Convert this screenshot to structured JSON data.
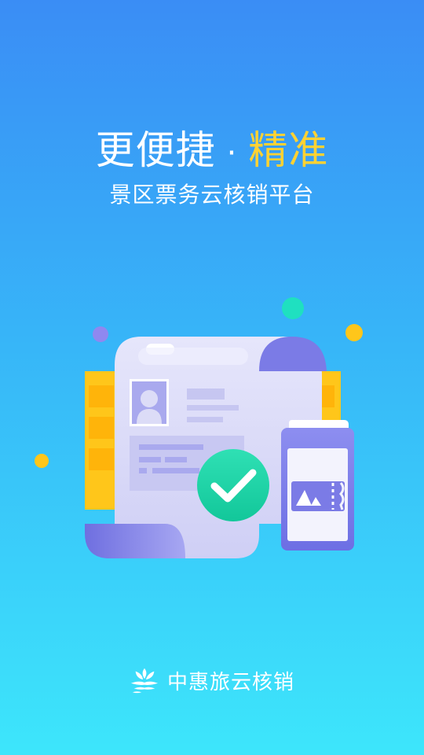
{
  "headline": {
    "main": "更便捷",
    "separator": "·",
    "accent": "精准"
  },
  "subtitle": "景区票务云核销平台",
  "brand": {
    "logo_icon": "zhonghui-logo-icon",
    "name": "中惠旅云核销"
  },
  "illustration": {
    "icons": [
      "id-card-document-icon",
      "checkmark-icon",
      "phone-ticket-icon",
      "mountain-icon"
    ]
  },
  "colors": {
    "background_top": "#3a8df5",
    "background_bottom": "#3de6fb",
    "accent": "#ffd233",
    "check_green": "#1ed5a6",
    "doc_lavender": "#dcdcf7",
    "doc_purple": "#7b7be6",
    "panel_yellow": "#ffc61a"
  }
}
